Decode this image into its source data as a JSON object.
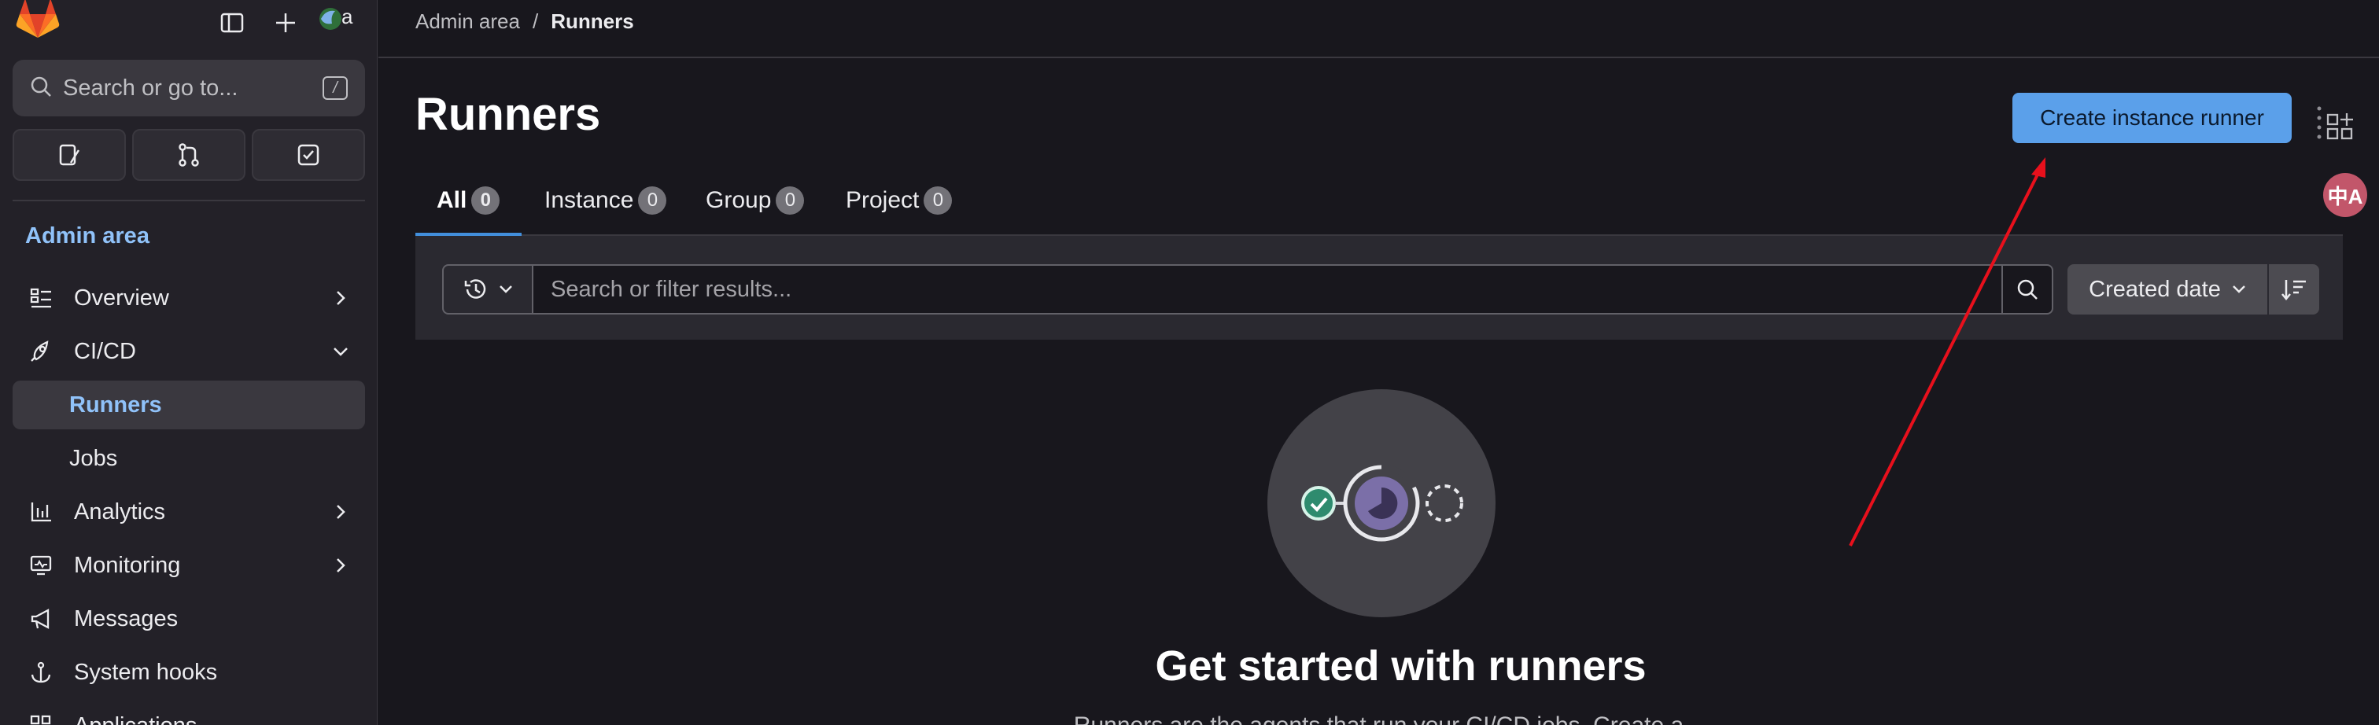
{
  "sidebar": {
    "search_placeholder": "Search or go to...",
    "search_shortcut": "/",
    "section_title": "Admin area",
    "items": [
      {
        "label": "Overview",
        "icon": "overview-icon",
        "expandable": true
      },
      {
        "label": "CI/CD",
        "icon": "rocket-icon",
        "expanded": true
      },
      {
        "label": "Runners",
        "active": true,
        "sub": true
      },
      {
        "label": "Jobs",
        "sub": true
      },
      {
        "label": "Analytics",
        "icon": "chart-icon",
        "expandable": true
      },
      {
        "label": "Monitoring",
        "icon": "monitor-icon",
        "expandable": true
      },
      {
        "label": "Messages",
        "icon": "megaphone-icon"
      },
      {
        "label": "System hooks",
        "icon": "anchor-icon"
      },
      {
        "label": "Applications",
        "icon": "apps-icon"
      }
    ],
    "avatar_text": "a"
  },
  "breadcrumb": {
    "parent": "Admin area",
    "separator": "/",
    "current": "Runners"
  },
  "page": {
    "title": "Runners",
    "create_button": "Create instance runner",
    "translate_label": "中A"
  },
  "tabs": [
    {
      "label": "All",
      "count": "0",
      "active": true
    },
    {
      "label": "Instance",
      "count": "0"
    },
    {
      "label": "Group",
      "count": "0"
    },
    {
      "label": "Project",
      "count": "0"
    }
  ],
  "filter": {
    "placeholder": "Search or filter results...",
    "sort_label": "Created date"
  },
  "empty_state": {
    "title": "Get started with runners",
    "subtitle": "Runners are the agents that run your CI/CD jobs. Create a"
  },
  "colors": {
    "accent": "#5ba0ea",
    "link": "#90c2f9",
    "annotation_arrow": "#e8101c"
  }
}
